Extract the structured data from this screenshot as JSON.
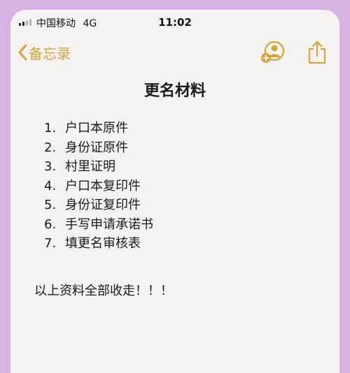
{
  "status_bar": {
    "carrier": "中国移动",
    "network": "4G",
    "time": "11:02"
  },
  "nav": {
    "back_label": "备忘录",
    "accent_color": "#d6a43a"
  },
  "note": {
    "title": "更名材料",
    "items": [
      {
        "num": "1.",
        "text": "户口本原件"
      },
      {
        "num": "2.",
        "text": "身份证原件"
      },
      {
        "num": "3.",
        "text": "村里证明"
      },
      {
        "num": "4.",
        "text": "户口本复印件"
      },
      {
        "num": "5.",
        "text": "身份证复印件"
      },
      {
        "num": "6.",
        "text": "手写申请承诺书"
      },
      {
        "num": "7.",
        "text": "填更名审核表"
      }
    ],
    "footer": "以上资料全部收走！！！"
  }
}
